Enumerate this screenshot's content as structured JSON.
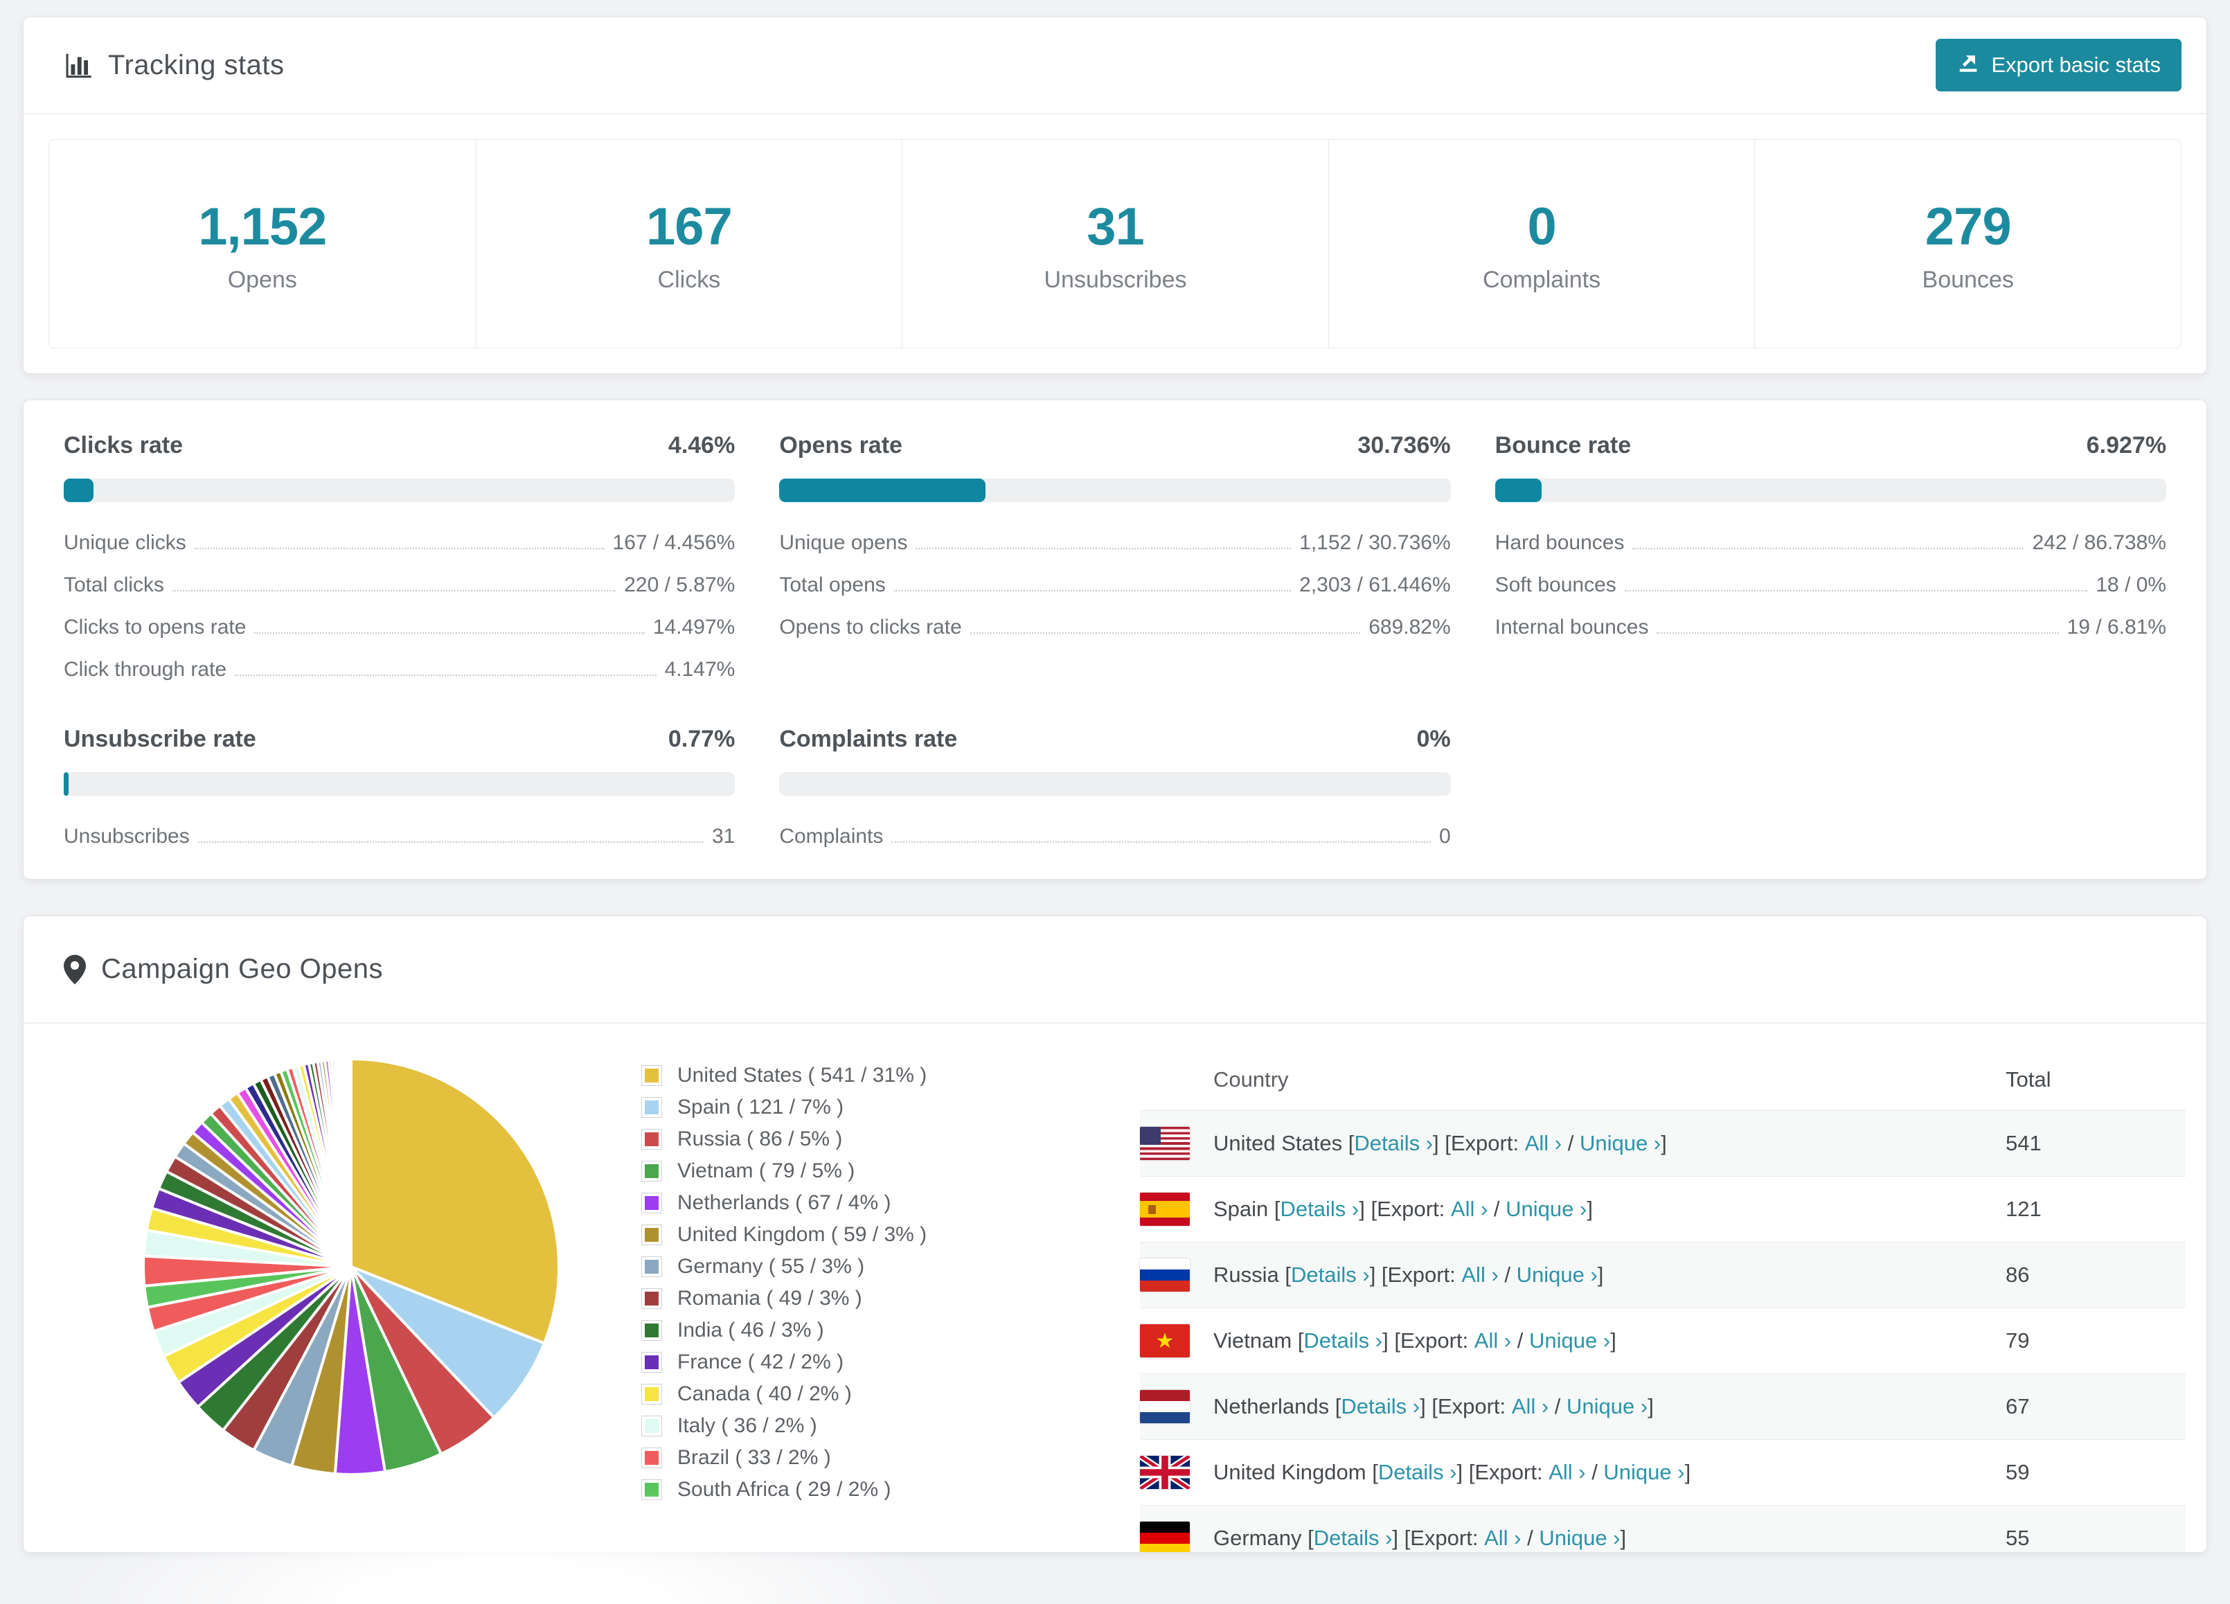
{
  "accent": {
    "teal": "#1b8a9e",
    "bar_fill": "#0f87a1",
    "link": "#2b93a8"
  },
  "tracking": {
    "title": "Tracking stats",
    "export_label": "Export basic stats",
    "summary": [
      {
        "value": "1,152",
        "label": "Opens"
      },
      {
        "value": "167",
        "label": "Clicks"
      },
      {
        "value": "31",
        "label": "Unsubscribes"
      },
      {
        "value": "0",
        "label": "Complaints"
      },
      {
        "value": "279",
        "label": "Bounces"
      }
    ]
  },
  "rates": {
    "clicks": {
      "title": "Clicks rate",
      "value": "4.46%",
      "percent": 4.46,
      "rows": [
        {
          "label": "Unique clicks",
          "value": "167 / 4.456%"
        },
        {
          "label": "Total clicks",
          "value": "220 / 5.87%"
        },
        {
          "label": "Clicks to opens rate",
          "value": "14.497%"
        },
        {
          "label": "Click through rate",
          "value": "4.147%"
        }
      ]
    },
    "opens": {
      "title": "Opens rate",
      "value": "30.736%",
      "percent": 30.736,
      "rows": [
        {
          "label": "Unique opens",
          "value": "1,152 / 30.736%"
        },
        {
          "label": "Total opens",
          "value": "2,303 / 61.446%"
        },
        {
          "label": "Opens to clicks rate",
          "value": "689.82%"
        }
      ]
    },
    "bounce": {
      "title": "Bounce rate",
      "value": "6.927%",
      "percent": 6.927,
      "rows": [
        {
          "label": "Hard bounces",
          "value": "242 / 86.738%"
        },
        {
          "label": "Soft bounces",
          "value": "18 / 0%"
        },
        {
          "label": "Internal bounces",
          "value": "19 / 6.81%"
        }
      ]
    },
    "unsubscribe": {
      "title": "Unsubscribe rate",
      "value": "0.77%",
      "percent": 0.77,
      "rows": [
        {
          "label": "Unsubscribes",
          "value": "31"
        }
      ]
    },
    "complaints": {
      "title": "Complaints rate",
      "value": "0%",
      "percent": 0,
      "rows": [
        {
          "label": "Complaints",
          "value": "0"
        }
      ]
    }
  },
  "geo": {
    "title": "Campaign Geo Opens",
    "legend": [
      {
        "label": "United States ( 541 / 31% )",
        "color": "#e4c03f"
      },
      {
        "label": "Spain ( 121 / 7% )",
        "color": "#a8d3f0"
      },
      {
        "label": "Russia ( 86 / 5% )",
        "color": "#cc4b4c"
      },
      {
        "label": "Vietnam ( 79 / 5% )",
        "color": "#4aa74d"
      },
      {
        "label": "Netherlands ( 67 / 4% )",
        "color": "#9c3df0"
      },
      {
        "label": "United Kingdom ( 59 / 3% )",
        "color": "#b0912f"
      },
      {
        "label": "Germany ( 55 / 3% )",
        "color": "#8aa8c0"
      },
      {
        "label": "Romania ( 49 / 3% )",
        "color": "#a03e3e"
      },
      {
        "label": "India ( 46 / 3% )",
        "color": "#2f7a33"
      },
      {
        "label": "France ( 42 / 2% )",
        "color": "#6a2fb5"
      },
      {
        "label": "Canada ( 40 / 2% )",
        "color": "#f6e442"
      },
      {
        "label": "Italy ( 36 / 2% )",
        "color": "#dffaf3"
      },
      {
        "label": "Brazil ( 33 / 2% )",
        "color": "#f05c5c"
      },
      {
        "label": "South Africa ( 29 / 2% )",
        "color": "#58c55c"
      }
    ],
    "table": {
      "headers": [
        "Country",
        "Total"
      ],
      "labels": {
        "details": "Details ›",
        "export_prefix": "Export:",
        "all": "All ›",
        "unique": "Unique ›",
        "lb": "[",
        "rb": "]",
        "sep": "/"
      },
      "rows": [
        {
          "flag": "us",
          "country": "United States",
          "total": "541"
        },
        {
          "flag": "es",
          "country": "Spain",
          "total": "121"
        },
        {
          "flag": "ru",
          "country": "Russia",
          "total": "86"
        },
        {
          "flag": "vn",
          "country": "Vietnam",
          "total": "79"
        },
        {
          "flag": "nl",
          "country": "Netherlands",
          "total": "67"
        },
        {
          "flag": "gb",
          "country": "United Kingdom",
          "total": "59"
        },
        {
          "flag": "de",
          "country": "Germany",
          "total": "55"
        }
      ]
    }
  },
  "chart_data": {
    "type": "pie",
    "title": "Campaign Geo Opens",
    "categories": [
      "United States",
      "Spain",
      "Russia",
      "Vietnam",
      "Netherlands",
      "United Kingdom",
      "Germany",
      "Romania",
      "India",
      "France",
      "Canada",
      "Italy",
      "Brazil",
      "South Africa"
    ],
    "values": [
      541,
      121,
      86,
      79,
      67,
      59,
      55,
      49,
      46,
      42,
      40,
      36,
      33,
      29
    ],
    "percent_labels": [
      "31%",
      "7%",
      "5%",
      "5%",
      "4%",
      "3%",
      "3%",
      "3%",
      "3%",
      "2%",
      "2%",
      "2%",
      "2%",
      "2%"
    ],
    "colors": [
      "#e4c03f",
      "#a8d3f0",
      "#cc4b4c",
      "#4aa74d",
      "#9c3df0",
      "#b0912f",
      "#8aa8c0",
      "#a03e3e",
      "#2f7a33",
      "#6a2fb5",
      "#f6e442",
      "#dffaf3",
      "#f05c5c",
      "#58c55c"
    ],
    "legend_position": "right",
    "start_angle_deg": -90,
    "small_weights": [
      40,
      35,
      30,
      28,
      25,
      23,
      21,
      19,
      18,
      17,
      16,
      15,
      14,
      13,
      12,
      11,
      10,
      10,
      9,
      9,
      8,
      8,
      7,
      7,
      6,
      6,
      5,
      5,
      5,
      4,
      4,
      4,
      3,
      3,
      3,
      2,
      2,
      2,
      2,
      1
    ],
    "small_palette": [
      "#f05c5c",
      "#dffaf3",
      "#f6e442",
      "#6a2fb5",
      "#2f7a33",
      "#a03e3e",
      "#8aa8c0",
      "#b0912f",
      "#9c3df0",
      "#4caf50",
      "#cc4b4c",
      "#a8d3f0",
      "#e4c03f",
      "#e44fe4",
      "#2b2b8e",
      "#1b5e20",
      "#7a1f1f",
      "#4f6d8f",
      "#8f7a12",
      "#58c55c"
    ]
  }
}
